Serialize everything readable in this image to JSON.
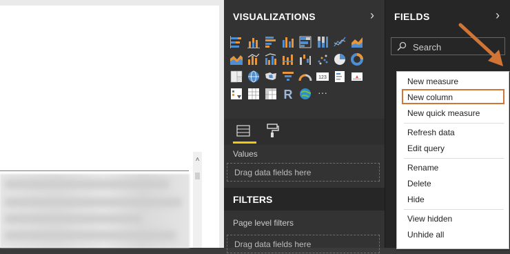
{
  "visualizations": {
    "title": "VISUALIZATIONS",
    "icons": [
      "stacked-bar-chart-icon",
      "stacked-column-chart-icon",
      "clustered-bar-chart-icon",
      "clustered-column-chart-icon",
      "100-percent-stacked-bar-icon",
      "100-percent-stacked-column-icon",
      "line-chart-icon",
      "area-chart-icon",
      "stacked-area-chart-icon",
      "line-and-stacked-column-icon",
      "line-and-clustered-column-icon",
      "ribbon-chart-icon",
      "waterfall-chart-icon",
      "scatter-chart-icon",
      "pie-chart-icon",
      "donut-chart-icon",
      "treemap-icon",
      "map-icon",
      "filled-map-icon",
      "funnel-icon",
      "gauge-icon",
      "card-icon",
      "multi-row-card-icon",
      "kpi-icon",
      "slicer-icon",
      "table-icon",
      "matrix-icon",
      "r-script-visual-icon",
      "arcgis-map-icon",
      "more-visuals-icon"
    ],
    "r_label": "R",
    "more_label": "···",
    "values_label": "Values",
    "drop_placeholder": "Drag data fields here"
  },
  "filters": {
    "title": "FILTERS",
    "page_level_label": "Page level filters",
    "drop_placeholder": "Drag data fields here"
  },
  "fields": {
    "title": "FIELDS",
    "search_placeholder": "Search",
    "more_options": "···"
  },
  "context_menu": {
    "items": [
      "New measure",
      "New column",
      "New quick measure",
      "Refresh data",
      "Edit query",
      "Rename",
      "Delete",
      "Hide",
      "View hidden",
      "Unhide all"
    ],
    "highlighted": "New column"
  },
  "colors": {
    "accent_yellow": "#f2c811",
    "highlight_orange": "#d07536",
    "viz_orange": "#e8963c",
    "viz_blue": "#4f8fd1"
  }
}
